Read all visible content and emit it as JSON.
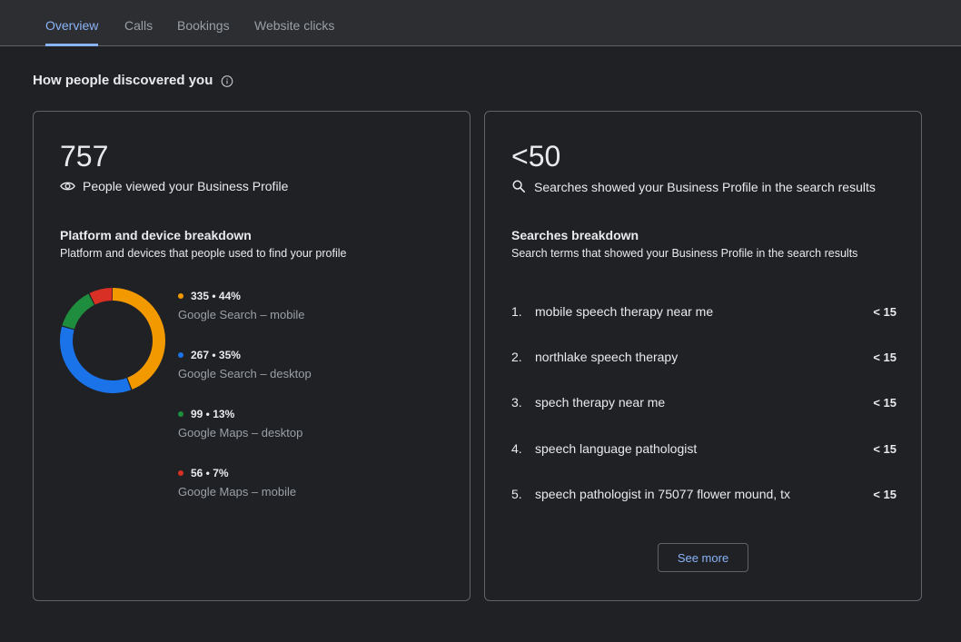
{
  "tabs": [
    {
      "label": "Overview",
      "active": true
    },
    {
      "label": "Calls",
      "active": false
    },
    {
      "label": "Bookings",
      "active": false
    },
    {
      "label": "Website clicks",
      "active": false
    }
  ],
  "section": {
    "title": "How people discovered you"
  },
  "views_card": {
    "total": "757",
    "metric_label": "People viewed your Business Profile",
    "breakdown_title": "Platform and device breakdown",
    "breakdown_desc": "Platform and devices that people used to find your profile",
    "segments": [
      {
        "value": "335 • 44%",
        "label": "Google Search – mobile",
        "count": 335,
        "color": "#f29900"
      },
      {
        "value": "267 • 35%",
        "label": "Google Search – desktop",
        "count": 267,
        "color": "#1a73e8"
      },
      {
        "value": "99 • 13%",
        "label": "Google Maps – desktop",
        "count": 99,
        "color": "#1e8e3e"
      },
      {
        "value": "56 • 7%",
        "label": "Google Maps – mobile",
        "count": 56,
        "color": "#d93025"
      }
    ]
  },
  "searches_card": {
    "total": "<50",
    "metric_label": "Searches showed your Business Profile in the search results",
    "breakdown_title": "Searches breakdown",
    "breakdown_desc": "Search terms that showed your Business Profile in the search results",
    "items": [
      {
        "index": "1.",
        "term": "mobile speech therapy near me",
        "count": "< 15"
      },
      {
        "index": "2.",
        "term": "northlake speech therapy",
        "count": "< 15"
      },
      {
        "index": "3.",
        "term": "spech therapy near me",
        "count": "< 15"
      },
      {
        "index": "4.",
        "term": "speech language pathologist",
        "count": "< 15"
      },
      {
        "index": "5.",
        "term": "speech pathologist in 75077 flower mound, tx",
        "count": "< 15"
      }
    ],
    "see_more_label": "See more"
  }
}
